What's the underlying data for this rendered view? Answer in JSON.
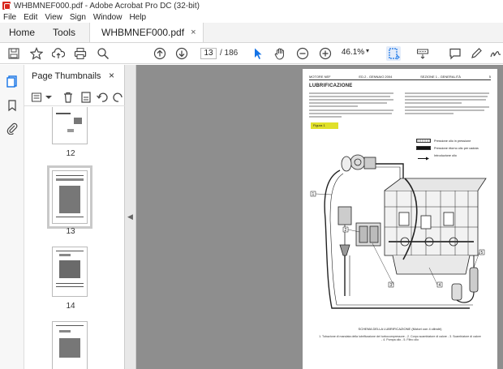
{
  "window": {
    "title": "WHBMNEF000.pdf - Adobe Acrobat Pro DC (32-bit)"
  },
  "menu": [
    "File",
    "Edit",
    "View",
    "Sign",
    "Window",
    "Help"
  ],
  "tabs": {
    "home": "Home",
    "tools": "Tools",
    "document": "WHBMNEF000.pdf",
    "close": "×"
  },
  "toolbar": {
    "current_page": "13",
    "total_pages": "/ 186",
    "zoom": "46.1%",
    "zoom_arrow": "▾"
  },
  "thumbnail_panel": {
    "title": "Page Thumbnails",
    "close": "×",
    "pages": [
      {
        "label": "12",
        "selected": false
      },
      {
        "label": "13",
        "selected": true
      },
      {
        "label": "14",
        "selected": false
      },
      {
        "label": "",
        "selected": false
      }
    ]
  },
  "document_page": {
    "header_left": "MOTORE NEF",
    "header_center": "ED.2 - GENNAIO 2004",
    "header_right": "SEZIONE 1 - GENERALITÀ",
    "header_page": "5",
    "section_title": "LUBRIFICAZIONE",
    "figure_tag": "Figura 1",
    "legend": [
      {
        "text": "Pressione olio in pressione",
        "color": "#ffffff",
        "pattern": "grey"
      },
      {
        "text": "Pressione ritorno olio per caduta",
        "color": "#111111",
        "pattern": "solid"
      },
      {
        "text": "Introduzione olio",
        "color": "#ffffff",
        "pattern": "arrow"
      }
    ],
    "caption": "SCHEMA DELLA LUBRIFICAZIONE (Motori con 4 cilindri)",
    "caption_detail": "1. Tubazione di mandata della lubrificazione del turbocompressore - 2. Corpo scambiatore di calore - 3. Scambiatore di calore - 4. Pompa olio - 5. Filtro olio"
  },
  "colors": {
    "accent_red": "#d8261c",
    "selected_blue": "#1473e6",
    "doc_bg": "#8e8e8e"
  }
}
